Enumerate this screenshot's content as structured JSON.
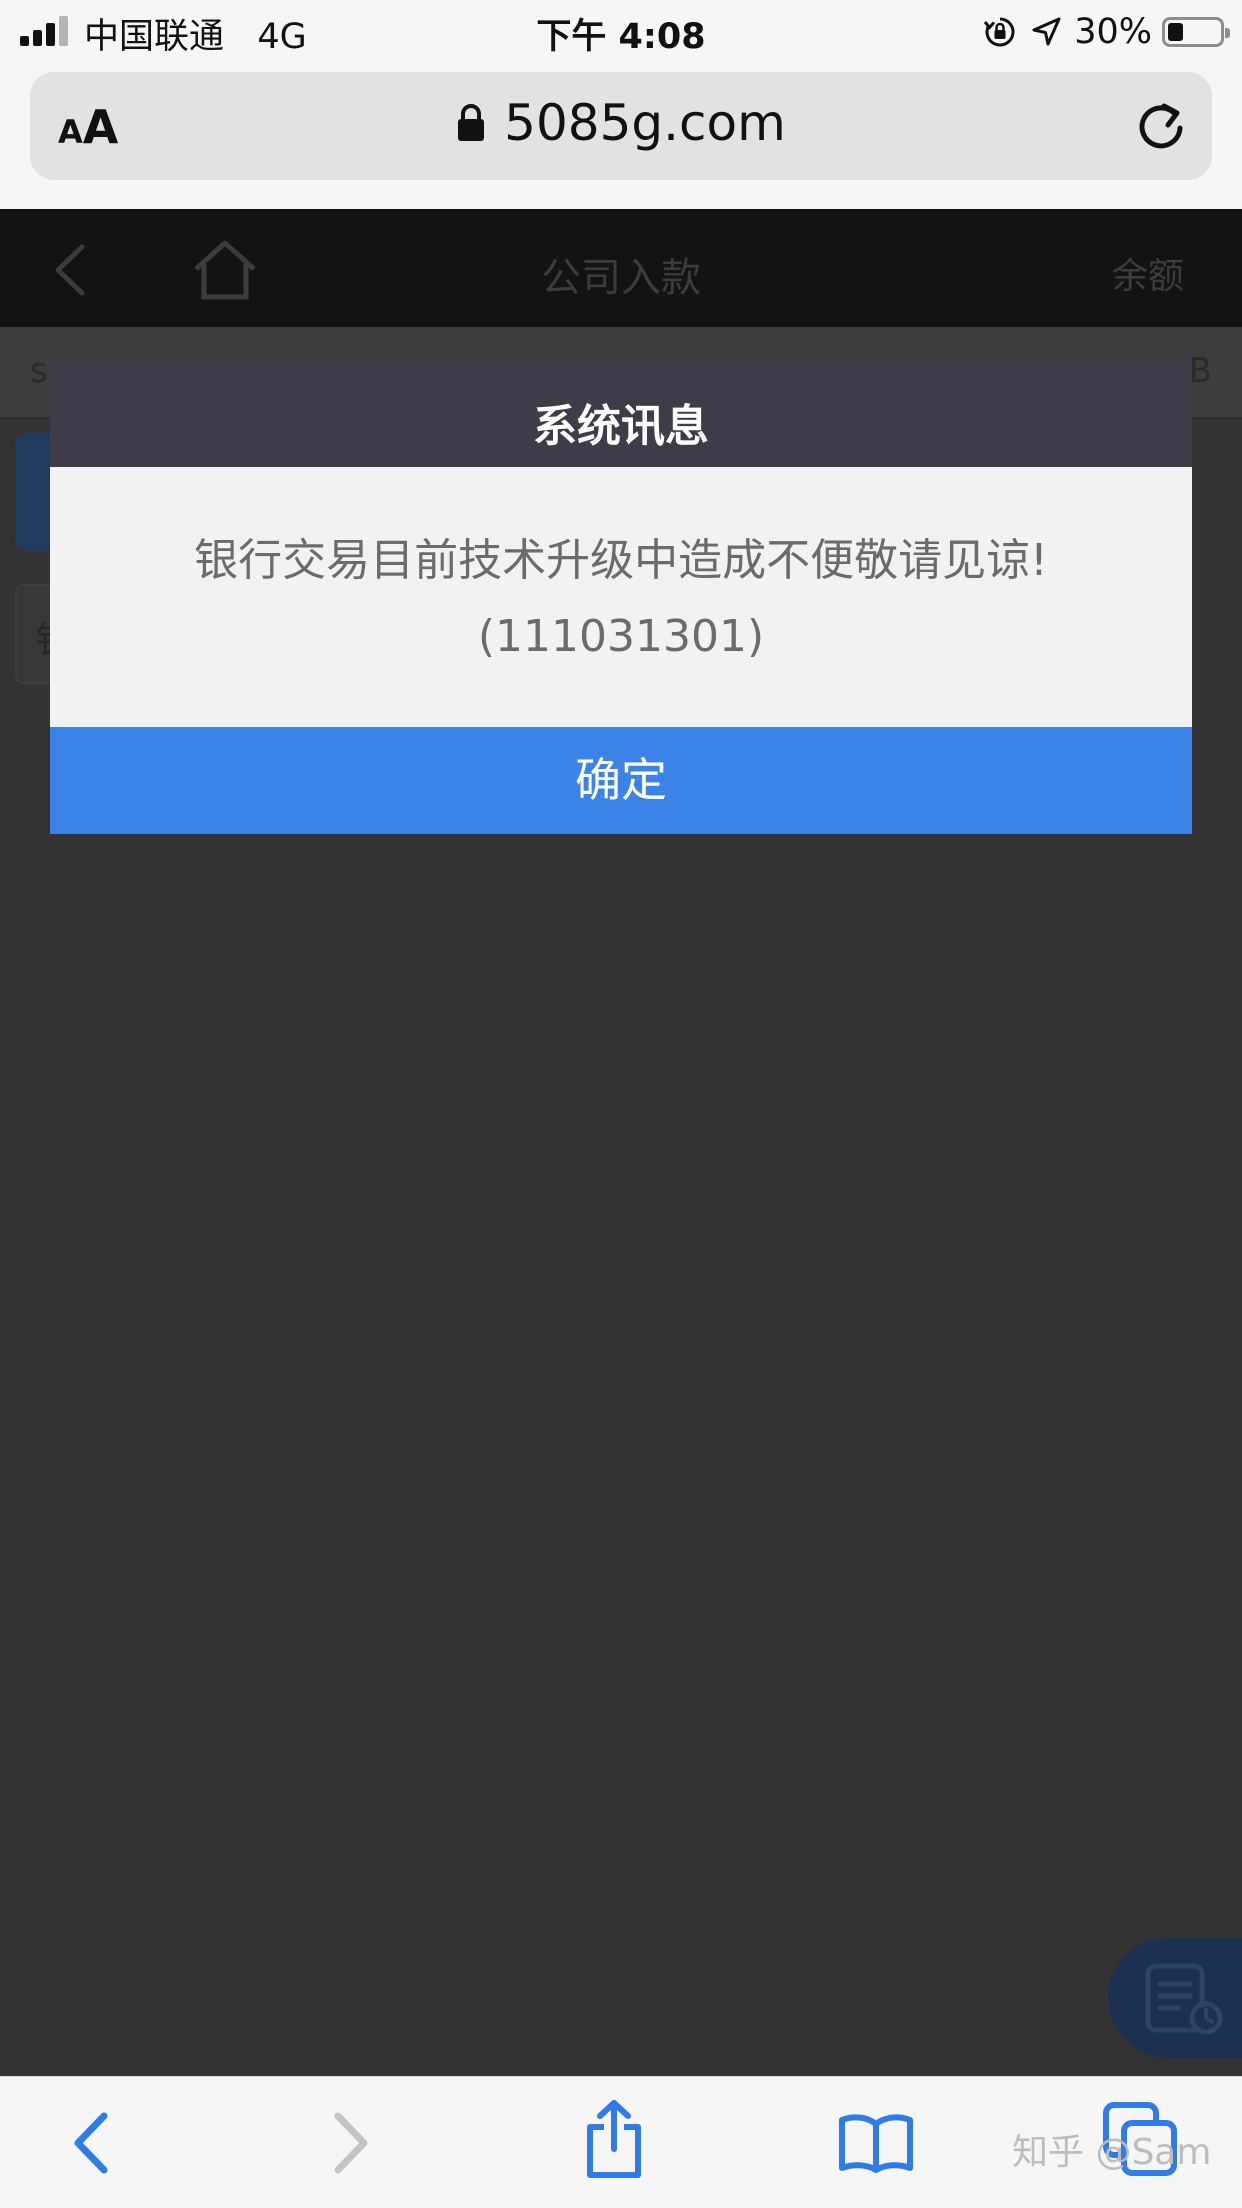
{
  "status_bar": {
    "carrier": "中国联通",
    "network": "4G",
    "time": "下午 4:08",
    "battery_percent": "30%",
    "battery_level": 0.3
  },
  "browser": {
    "aa_small": "A",
    "aa_large": "A",
    "url": "5085g.com"
  },
  "page": {
    "title": "公司入款",
    "balance_link": "余额",
    "info_left": "s",
    "info_right": "B",
    "form_label_partial": "钅"
  },
  "modal": {
    "title": "系统讯息",
    "message": "银行交易目前技术升级中造成不便敬请见谅!",
    "code": "(111031301)",
    "ok_label": "确定"
  },
  "toolbar": {
    "watermark": "知乎 @Sam"
  },
  "colors": {
    "modal_header": "#3d3c49",
    "modal_button": "#3c83e8",
    "toolbar_icon": "#2f7bea",
    "overlay": "#333333"
  },
  "icons": {
    "back": "chevron-left-icon",
    "forward": "chevron-right-icon",
    "share": "share-icon",
    "bookmarks": "book-icon",
    "tabs": "tabs-icon",
    "reload": "reload-icon",
    "padlock": "padlock-icon",
    "page_back": "page-back-icon",
    "home": "home-icon",
    "floating": "records-icon"
  }
}
